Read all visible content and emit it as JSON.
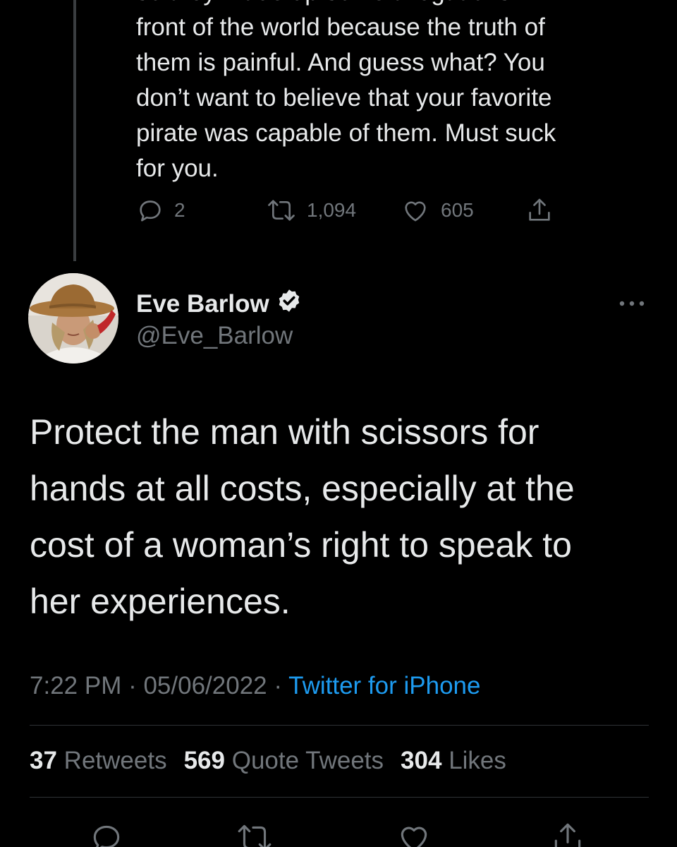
{
  "parent_tweet": {
    "text_lines": [
      "so they made up some allegations in",
      "front of the world because the truth of",
      "them is painful. And guess what? You",
      "don’t want to believe that your favorite",
      "pirate was capable of them. Must suck",
      "for you."
    ],
    "actions": {
      "reply": {
        "icon": "reply-icon",
        "count": "2"
      },
      "retweet": {
        "icon": "retweet-icon",
        "count": "1,094"
      },
      "like": {
        "icon": "heart-icon",
        "count": "605"
      },
      "share": {
        "icon": "share-icon"
      }
    }
  },
  "tweet": {
    "author": {
      "name": "Eve Barlow",
      "handle": "@Eve_Barlow",
      "verified": true
    },
    "text_lines": [
      "Protect the man with scissors for",
      "hands at all costs, especially at the",
      "cost of a woman’s right to speak to",
      "her experiences."
    ],
    "time": "7:22 PM",
    "date": "05/06/2022",
    "separator": " · ",
    "source": "Twitter for iPhone",
    "stats": {
      "retweets_count": "37",
      "retweets_label": "Retweets",
      "quotes_count": "569",
      "quotes_label": "Quote Tweets",
      "likes_count": "304",
      "likes_label": "Likes"
    }
  },
  "colors": {
    "background": "#000000",
    "text": "#e7e9ea",
    "secondary": "#71767b",
    "accent": "#1d9bf0",
    "divider": "#2f3336"
  }
}
